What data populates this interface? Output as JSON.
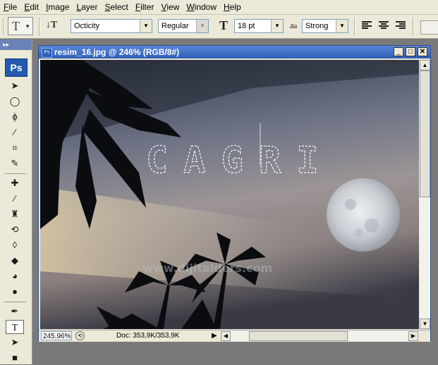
{
  "menubar": {
    "items": [
      {
        "label": "File",
        "u": "F",
        "rest": "ile"
      },
      {
        "label": "Edit",
        "u": "E",
        "rest": "dit"
      },
      {
        "label": "Image",
        "u": "I",
        "rest": "mage"
      },
      {
        "label": "Layer",
        "u": "L",
        "rest": "ayer"
      },
      {
        "label": "Select",
        "u": "S",
        "rest": "elect"
      },
      {
        "label": "Filter",
        "u": "F",
        "rest": "ilter"
      },
      {
        "label": "View",
        "u": "V",
        "rest": "iew"
      },
      {
        "label": "Window",
        "u": "W",
        "rest": "indow"
      },
      {
        "label": "Help",
        "u": "H",
        "rest": "elp"
      }
    ]
  },
  "options": {
    "font_family": "Octicity",
    "font_style": "Regular",
    "font_size": "18 pt",
    "aa_label": "a",
    "aa_label_sub": "a",
    "anti_alias": "Strong"
  },
  "toolbox": {
    "logo": "Ps"
  },
  "document": {
    "title": "resim_16.jpg @ 246% (RGB/8#)",
    "text_mask": "CAGRI",
    "watermark": "www.dijitalders.com"
  },
  "status": {
    "zoom": "245,96%",
    "doc_size": "Doc: 353,9K/353,9K"
  },
  "colors": {
    "accent": "#2e5eb6",
    "chrome": "#ece9d8"
  }
}
